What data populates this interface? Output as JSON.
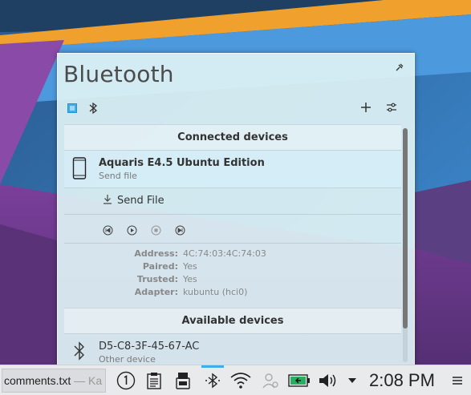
{
  "popup": {
    "title": "Bluetooth"
  },
  "sections": {
    "connected_header": "Connected devices",
    "available_header": "Available devices"
  },
  "connected_device": {
    "name": "Aquaris E4.5 Ubuntu Edition",
    "subtitle": "Send file",
    "icon": "smartphone-icon",
    "send_file_label": "Send File",
    "info": [
      {
        "label": "Address:",
        "value": "4C:74:03:4C:74:03"
      },
      {
        "label": "Paired:",
        "value": "Yes"
      },
      {
        "label": "Trusted:",
        "value": "Yes"
      },
      {
        "label": "Adapter:",
        "value": "kubuntu (hci0)"
      }
    ]
  },
  "available_device": {
    "name": "D5-C8-3F-45-67-AC",
    "subtitle": "Other device",
    "icon": "bluetooth-icon"
  },
  "taskbar": {
    "task_label": "comments.txt",
    "task_label_suffix": "— Ka",
    "clock": "2:08 PM",
    "accent": "#3daee9"
  },
  "colors": {
    "popup_bg": "#def1f4",
    "desktop_purple": "#6c3a8c",
    "desktop_blue": "#3a7ec4",
    "stripe_orange": "#f0a02c"
  }
}
